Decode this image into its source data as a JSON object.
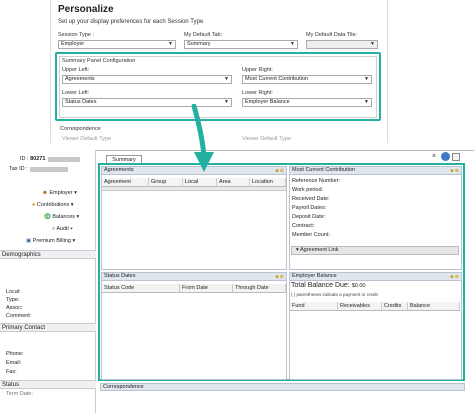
{
  "personalize": {
    "title": "Personalize",
    "subtitle": "Set up your display preferences for each Session Type",
    "session_type_label": "Session Type :",
    "session_type_value": "Employer",
    "default_tab_label": "My Default Tab:",
    "default_tab_value": "Summary",
    "default_tile_label": "My Default Data Tile:",
    "default_tile_value": "",
    "config_title": "Summary Panel Configuration",
    "upper_left_label": "Upper Left:",
    "upper_left_value": "Agreements",
    "upper_right_label": "Upper Right:",
    "upper_right_value": "Most Current Contribution",
    "lower_left_label": "Lower Left:",
    "lower_left_value": "Status Dates",
    "lower_right_label": "Lower Right:",
    "lower_right_value": "Employer Balance",
    "correspondence_label": "Correspondence",
    "viewer_default_type_label": "Viewer Default Type"
  },
  "sidebar": {
    "id_label": "ID :",
    "id_value": "80271",
    "taxid_label": "Tax ID :",
    "menu": [
      {
        "label": "Employer"
      },
      {
        "label": "Contributions"
      },
      {
        "label": "Balances"
      },
      {
        "label": "Audit"
      },
      {
        "label": "Premium Billing"
      }
    ],
    "demographics_header": "Demographics",
    "demographics_fields": [
      "Local:",
      "Type:",
      "Assoc:",
      "Comment:"
    ],
    "primary_contact_header": "Primary Contact",
    "contact_fields": [
      "Phone:",
      "Email:",
      "Fax:"
    ],
    "status_header": "Status",
    "status_field": "Term Date:"
  },
  "tabs": {
    "summary": "Summary"
  },
  "agreements": {
    "title": "Agreements",
    "columns": [
      "Agreement",
      "Group",
      "Local",
      "Area",
      "Location"
    ]
  },
  "most_current_contribution": {
    "title": "Most Current Contribution",
    "fields": [
      "Reference Number:",
      "Work period:",
      "Received Date:",
      "Payroll Dates:",
      "Deposit Date:",
      "Contract:",
      "Member Count:"
    ],
    "agreement_link": "Agreement Link"
  },
  "status_dates": {
    "title": "Status Dates",
    "columns": [
      "Status Code",
      "From Date",
      "Through Date"
    ]
  },
  "employer_balance": {
    "title": "Employer Balance",
    "total_label": "Total Balance Due:",
    "total_value": "$0.00",
    "note": "( ) parentheses indicate a payment or credit",
    "columns": [
      "Fund",
      "Receivables",
      "Credits",
      "Balance"
    ]
  },
  "correspondence": {
    "title": "Correspondence"
  },
  "colors": {
    "accent": "#23b0a0",
    "panel_header": "#dfe6ee"
  }
}
